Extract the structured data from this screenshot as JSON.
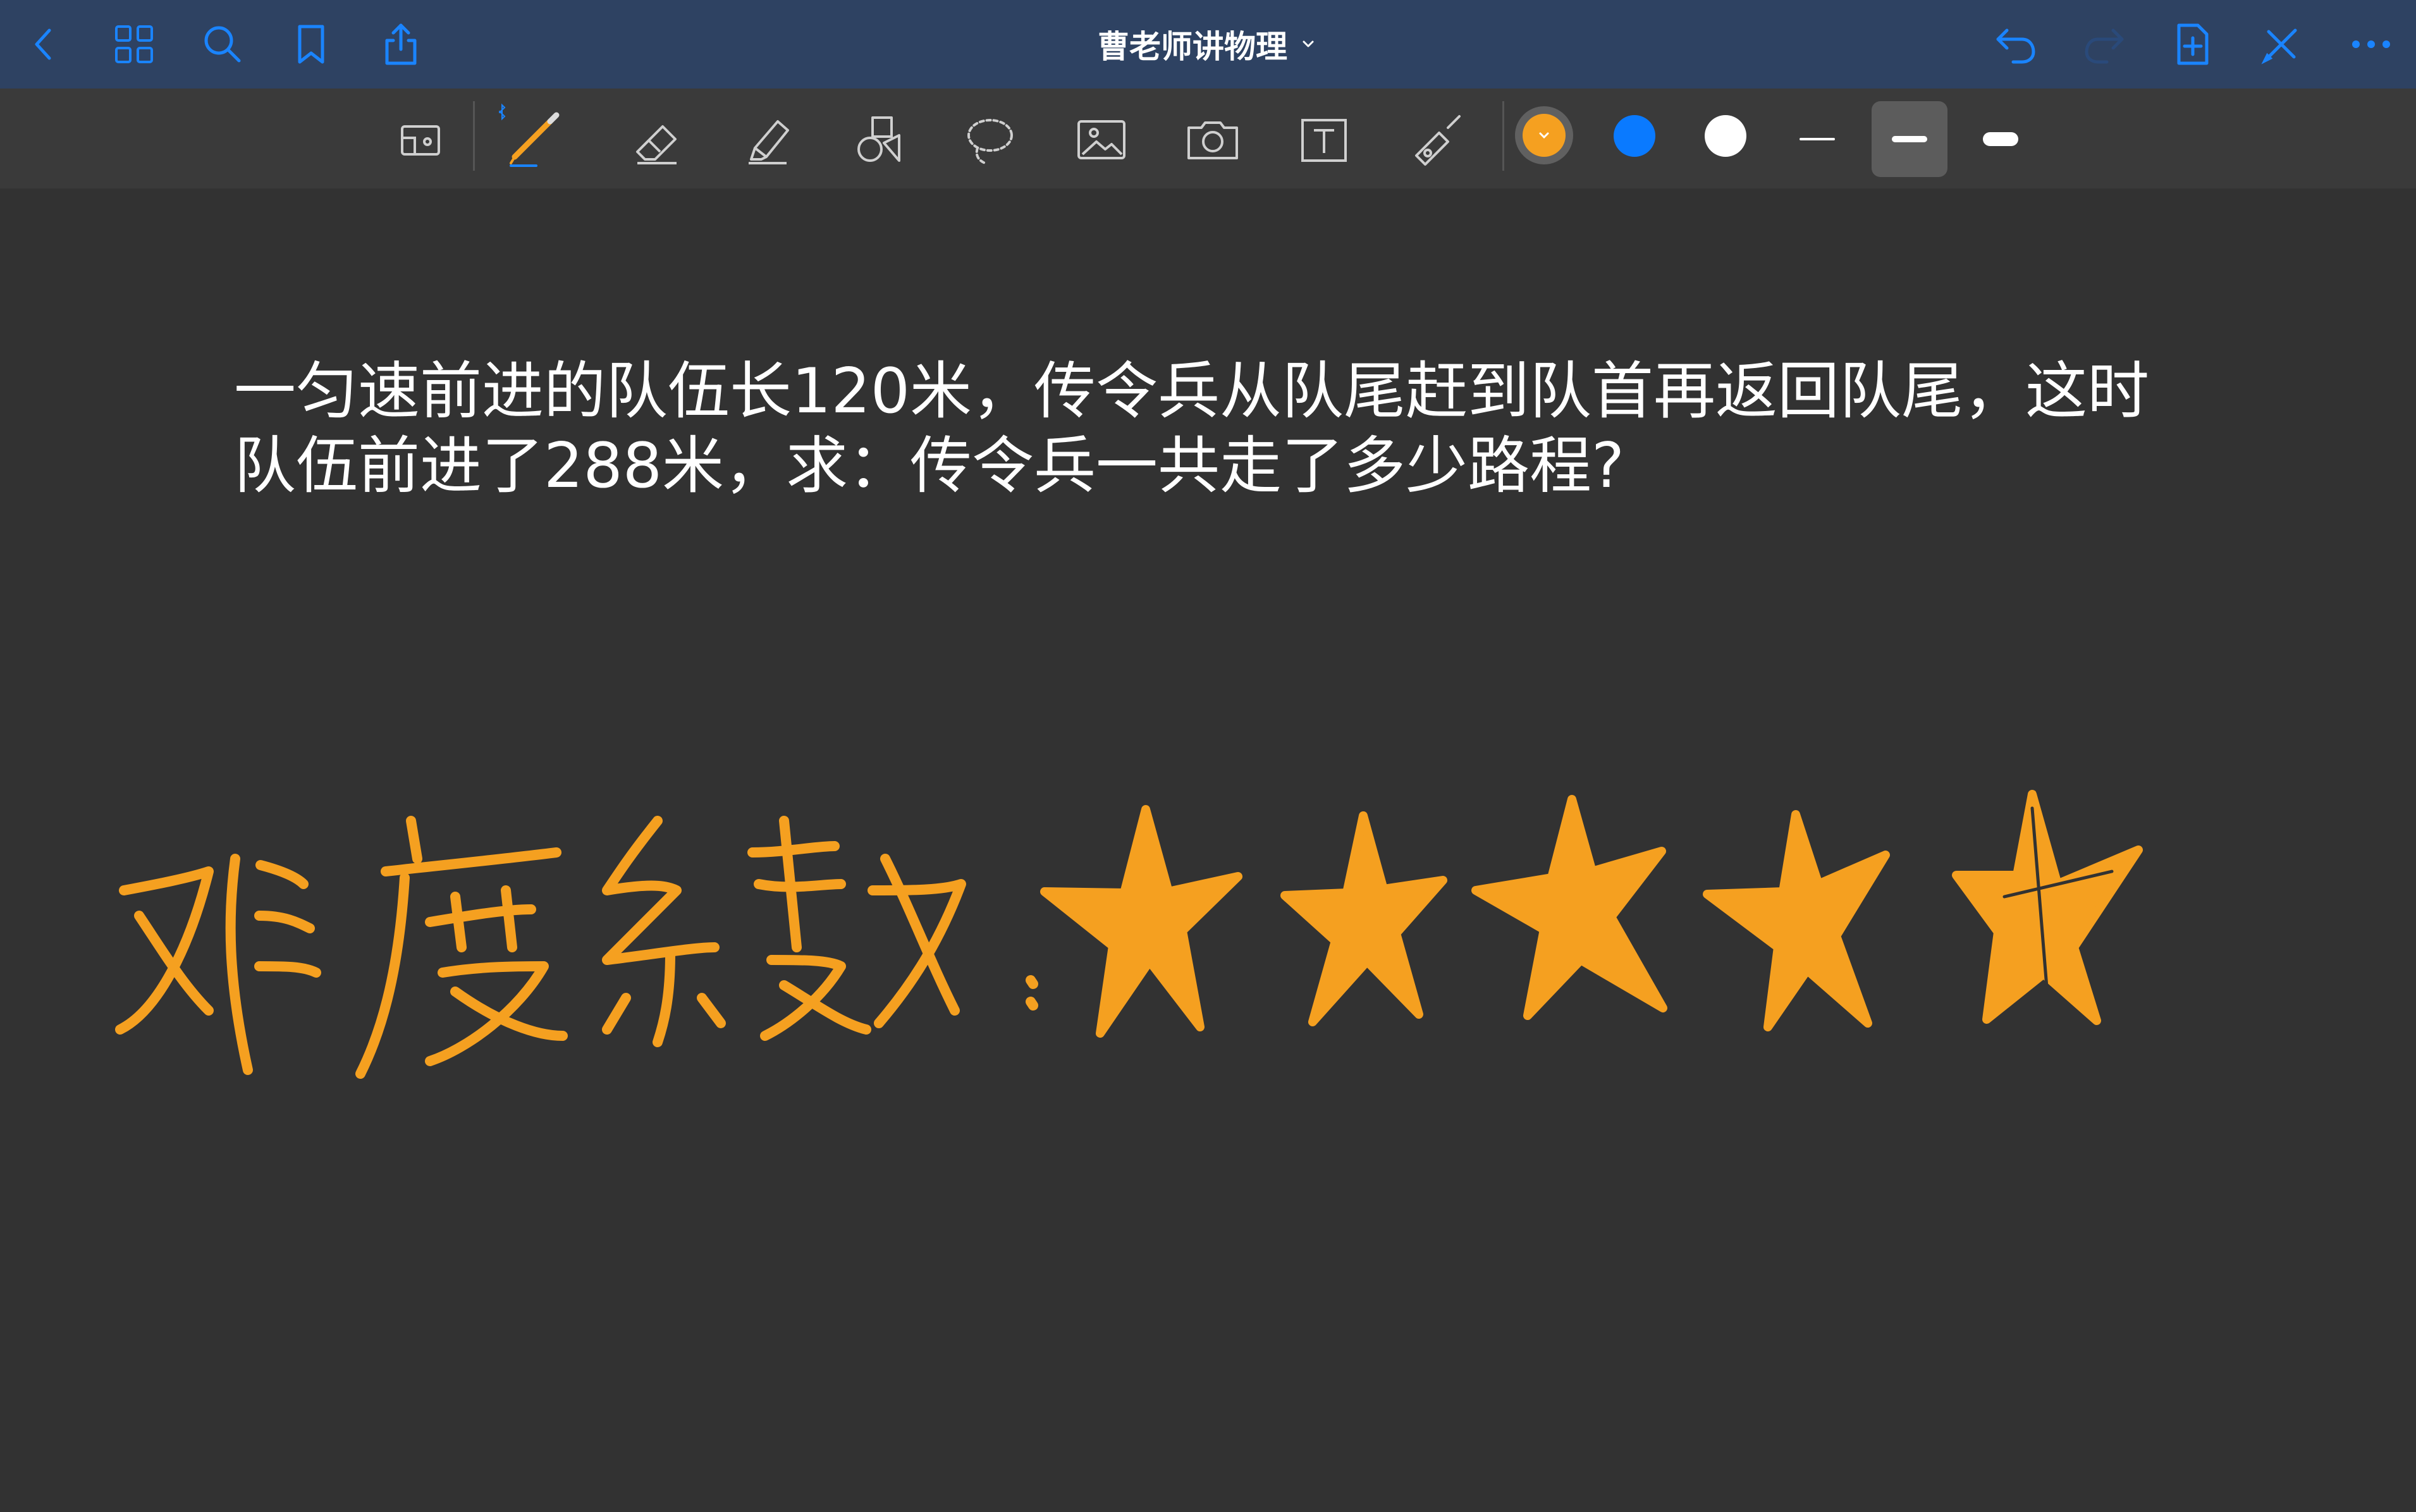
{
  "header": {
    "title": "曹老师讲物理",
    "icons": {
      "back": "chevron-left-icon",
      "grid": "grid-icon",
      "search": "search-icon",
      "bookmark": "bookmark-icon",
      "share": "share-icon",
      "undo": "undo-icon",
      "redo": "redo-icon",
      "add_page": "add-page-icon",
      "close_pen": "pen-off-icon",
      "more": "more-icon"
    }
  },
  "toolbar": {
    "tools": [
      "page-view-icon",
      "pen-icon",
      "eraser-icon",
      "highlighter-icon",
      "shapes-icon",
      "lasso-icon",
      "image-icon",
      "camera-icon",
      "text-box-icon",
      "laser-pointer-icon"
    ],
    "colors": [
      "#f5a020",
      "#0a7aff",
      "#ffffff"
    ],
    "selected_color": "#f5a020",
    "stroke_widths": [
      "thin",
      "medium",
      "thick"
    ],
    "selected_stroke": "medium"
  },
  "document": {
    "question_line1": "一匀速前进的队伍长120米，传令兵从队尾赶到队首再返回队尾，这时",
    "question_line2": "队伍前进了288米，求：传令兵一共走了多少路程?",
    "handwriting": {
      "label": "难度系数：",
      "stars": 5,
      "ink_color": "#f5a020"
    }
  }
}
